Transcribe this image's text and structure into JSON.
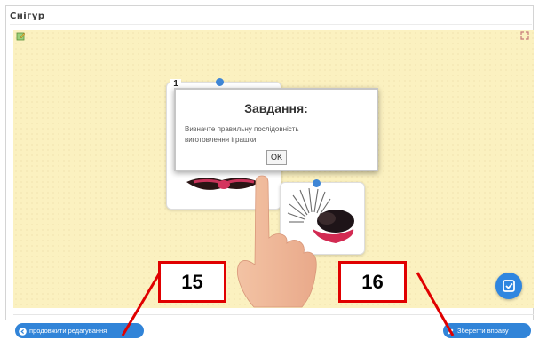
{
  "window": {
    "title": "Снігур"
  },
  "exercise": {
    "card_number": "1"
  },
  "dialog": {
    "title": "Завдання:",
    "text": "Визначте правильну послідовність виготовлення іграшки",
    "ok_label": "OK"
  },
  "footer": {
    "back_label": "продовжити редагування",
    "save_label": "Зберегти вправу"
  },
  "callouts": {
    "left": "15",
    "right": "16"
  },
  "colors": {
    "canvas_bg": "#fbf1c0",
    "accent_blue": "#3184d8",
    "callout_red": "#e00000"
  },
  "icons": [
    "edit-icon",
    "fullscreen-icon",
    "check-icon",
    "arrow-left-icon",
    "pencil-icon",
    "hand-pointer-icon"
  ]
}
